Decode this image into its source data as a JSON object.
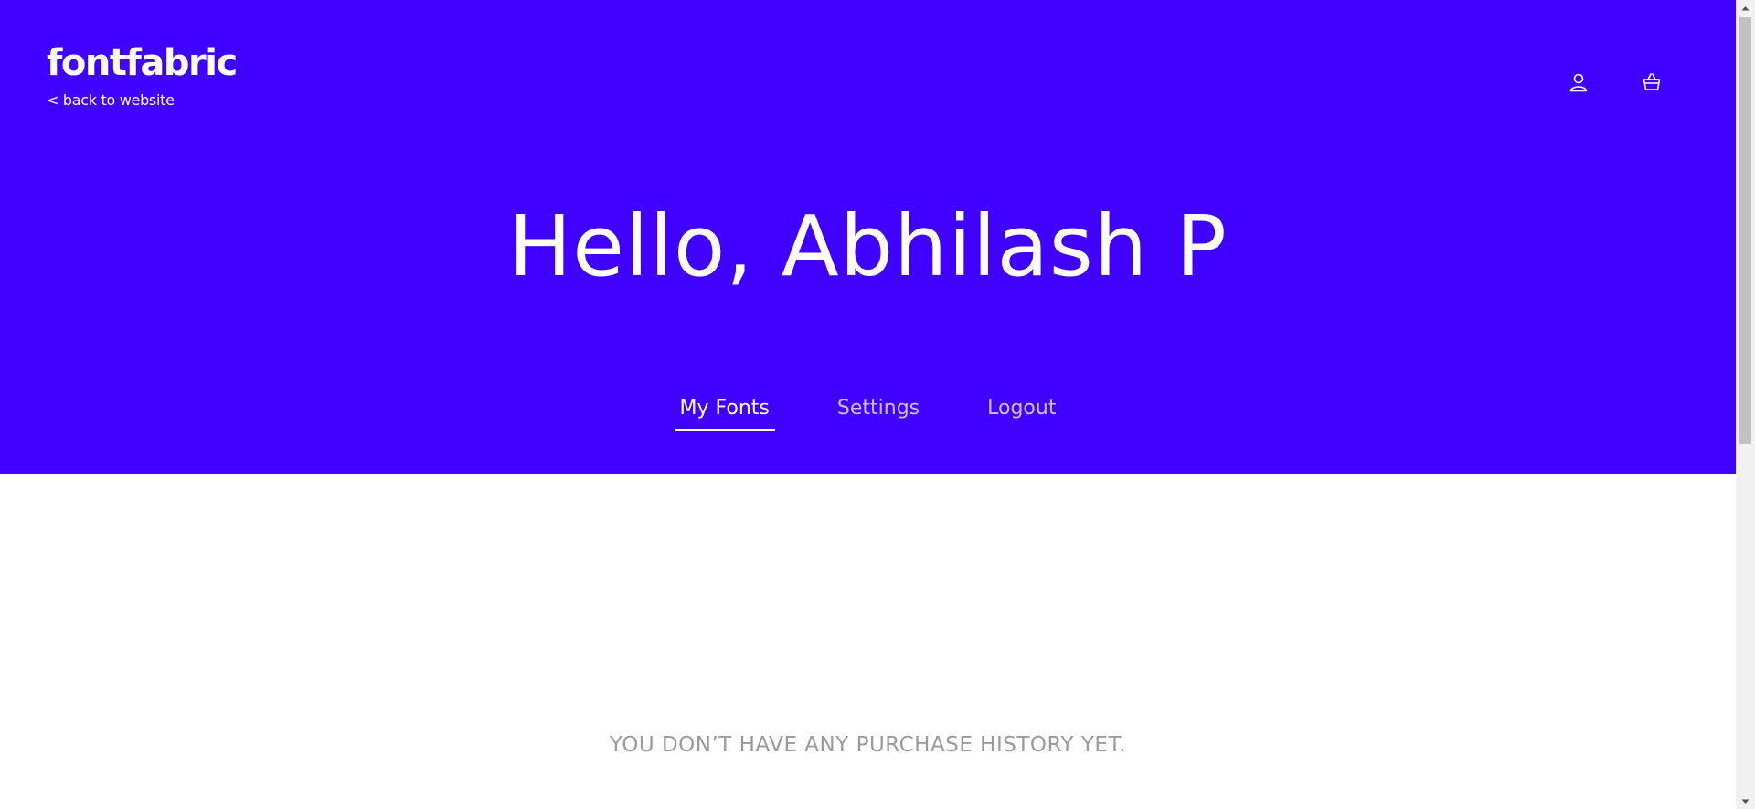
{
  "header": {
    "logo_text": "fontfabric",
    "back_link": "< back to website",
    "icons": [
      "user-icon",
      "basket-icon"
    ]
  },
  "hero": {
    "greeting": "Hello, Abhilash P",
    "background_color": "#4000ff"
  },
  "tabs": [
    {
      "label": "My Fonts",
      "active": true
    },
    {
      "label": "Settings",
      "active": false
    },
    {
      "label": "Logout",
      "active": false
    }
  ],
  "main": {
    "empty_message": "YOU DON’T HAVE ANY PURCHASE HISTORY YET."
  }
}
